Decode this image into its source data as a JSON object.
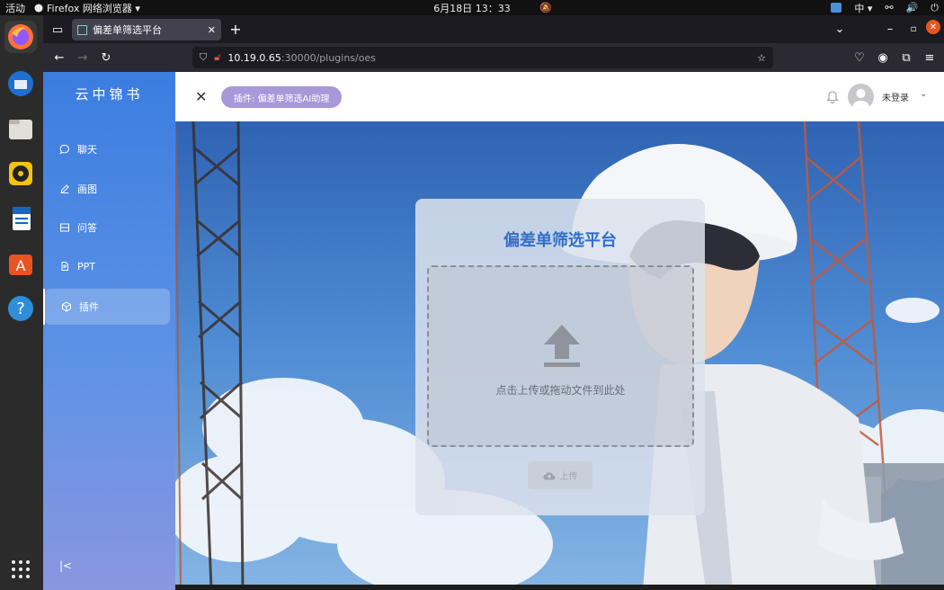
{
  "topbar": {
    "activities": "活动",
    "app_menu": "Firefox 网络浏览器 ▾",
    "clock": "6月18日 13：33",
    "input_method": "中 ▾"
  },
  "browser": {
    "tab_title": "偏差单筛选平台",
    "url_host": "10.19.0.65",
    "url_rest": ":30000/plugins/oes"
  },
  "app": {
    "brand": "云中锦书",
    "menu": [
      {
        "label": "聊天",
        "icon": "chat-icon"
      },
      {
        "label": "画图",
        "icon": "pen-icon"
      },
      {
        "label": "问答",
        "icon": "qa-icon"
      },
      {
        "label": "PPT",
        "icon": "ppt-icon"
      },
      {
        "label": "插件",
        "icon": "plugin-icon",
        "active": true
      }
    ],
    "collapse": "|<",
    "header": {
      "pill": "插件: 偏差单筛选AI助理",
      "user": "未登录"
    }
  },
  "uploader": {
    "title": "偏差单筛选平台",
    "drop_hint": "点击上传或拖动文件到此处",
    "upload_label": "上传"
  },
  "colors": {
    "sidebar_top": "#3b7de0",
    "accent": "#2f6fca",
    "pill": "#a897d9"
  }
}
